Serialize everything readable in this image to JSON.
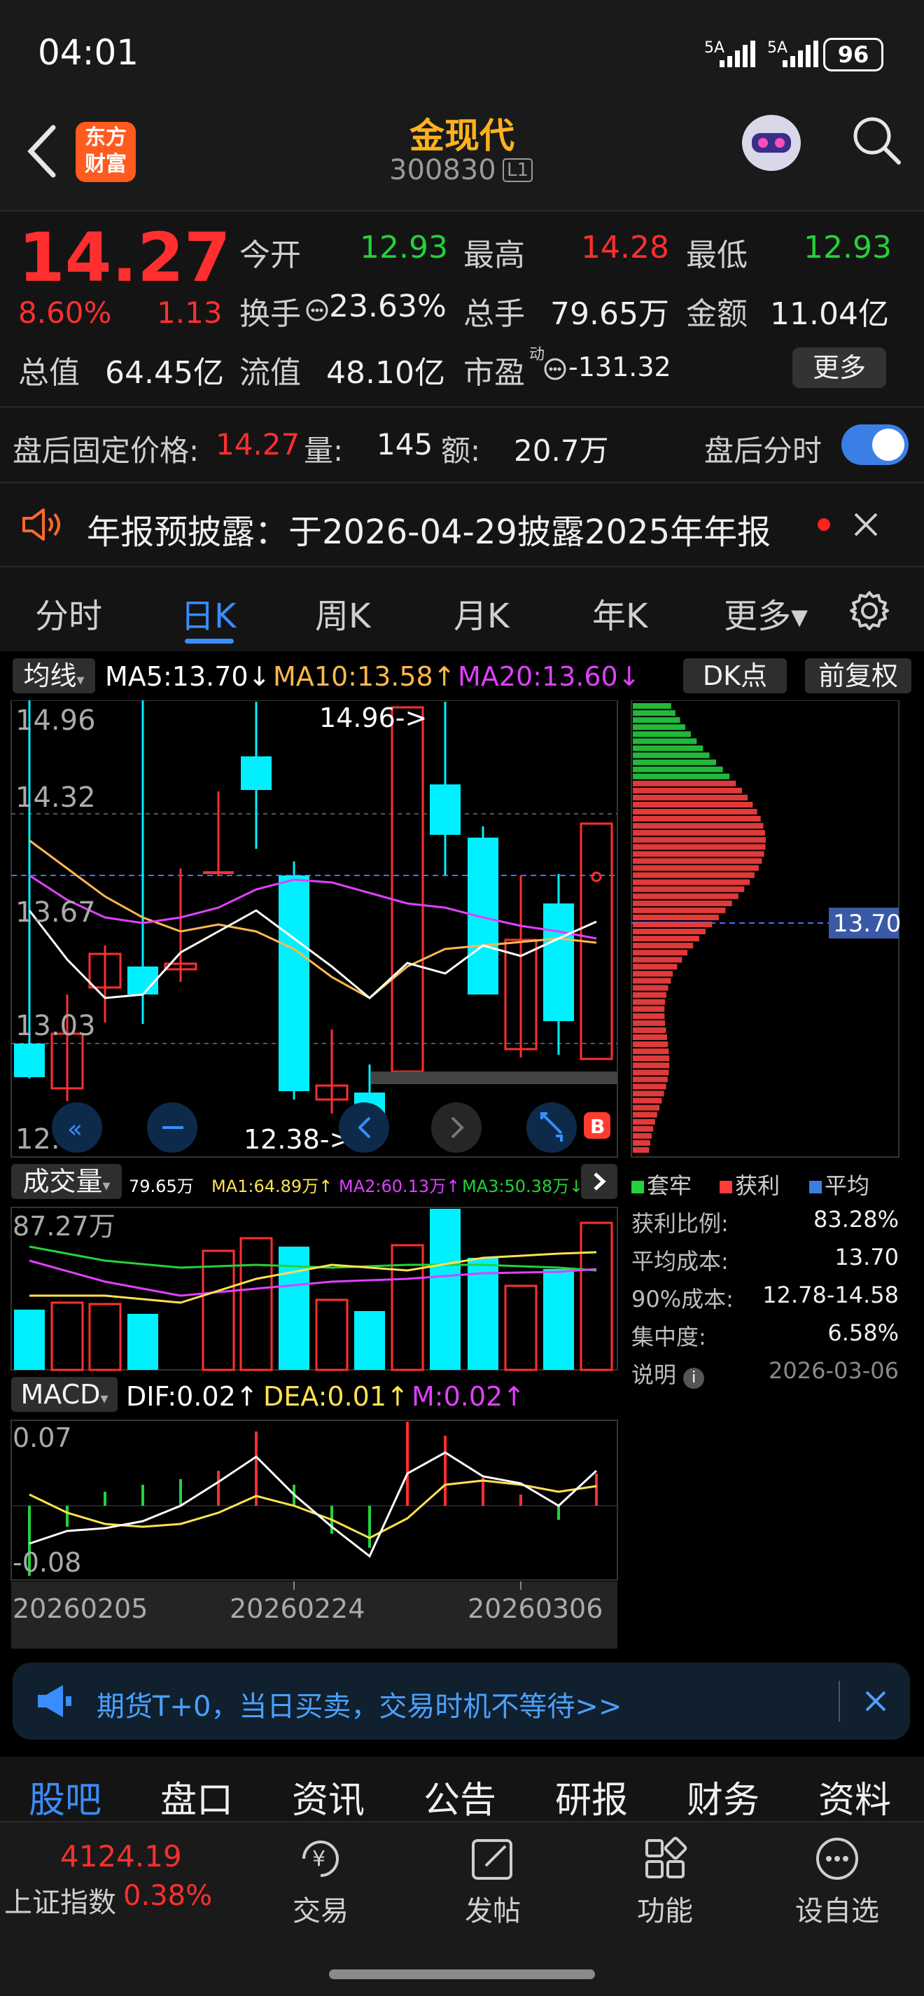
{
  "status_bar": {
    "time": "04:01",
    "signal1": "5A",
    "signal2": "5A",
    "battery": "96"
  },
  "header": {
    "name": "金现代",
    "code": "300830",
    "level": "L1",
    "logo_line1": "东方",
    "logo_line2": "财富"
  },
  "quote": {
    "price": "14.27",
    "change_pct": "8.60%",
    "change": "1.13",
    "open_label": "今开",
    "open": "12.93",
    "high_label": "最高",
    "high": "14.28",
    "low_label": "最低",
    "low": "12.93",
    "turnover_label": "换手",
    "turnover": "23.63%",
    "volume_label": "总手",
    "volume": "79.65万",
    "amount_label": "金额",
    "amount": "11.04亿",
    "mktcap_label": "总值",
    "mktcap": "64.45亿",
    "float_label": "流值",
    "float": "48.10亿",
    "pe_label": "市盈",
    "pe_sup": "动",
    "pe": "-131.32",
    "more_button": "更多"
  },
  "after_hours": {
    "label": "盘后固定价格:",
    "price": "14.27",
    "vol_label": "量:",
    "vol": "145",
    "amt_label": "额:",
    "amt": "20.7万",
    "toggle_label": "盘后分时"
  },
  "notice": {
    "text": "年报预披露：于2026-04-29披露2025年年报"
  },
  "tabs": [
    "分时",
    "日K",
    "周K",
    "月K",
    "年K",
    "更多▾"
  ],
  "ma_legend": {
    "selector": "均线",
    "ma5": "MA5:13.70↓",
    "ma10": "MA10:13.58↑",
    "ma20": "MA20:13.60↓",
    "dk_button": "DK点",
    "adjust_button": "前复权"
  },
  "kline": {
    "y_labels": [
      "14.96",
      "14.32",
      "13.67",
      "13.03",
      "12.38"
    ],
    "max_marker": "14.96->",
    "min_marker": "12.38->",
    "chip_price": "13.70"
  },
  "volume_panel": {
    "selector": "成交量",
    "total": "79.65万",
    "ma1": "MA1:64.89万↑",
    "ma2": "MA2:60.13万↑",
    "ma3": "MA3:50.38万↓",
    "ymax": "87.27万"
  },
  "macd_panel": {
    "selector": "MACD",
    "dif": "DIF:0.02↑",
    "dea": "DEA:0.01↑",
    "m": "M:0.02↑",
    "ymax": "0.07",
    "ymin": "-0.08"
  },
  "x_labels": [
    "20260205",
    "20260224",
    "20260306"
  ],
  "chip_dist": {
    "legend": [
      "套牢",
      "获利",
      "平均"
    ],
    "rows": [
      {
        "label": "获利比例:",
        "value": "83.28%"
      },
      {
        "label": "平均成本:",
        "value": "13.70"
      },
      {
        "label": "90%成本:",
        "value": "12.78-14.58"
      },
      {
        "label": "集中度:",
        "value": "6.58%"
      }
    ],
    "note_label": "说明",
    "date": "2026-03-06"
  },
  "ad_banner": {
    "text": "期货T+0，当日买卖，交易时机不等待>>"
  },
  "bottom_nav": [
    "股吧",
    "盘口",
    "资讯",
    "公告",
    "研报",
    "财务",
    "资料"
  ],
  "dock": {
    "index_value": "4124.19",
    "index_name": "上证指数",
    "index_change": "0.38%",
    "items": [
      "交易",
      "发帖",
      "功能",
      "设自选"
    ]
  },
  "colors": {
    "up": "#ff2f2f",
    "down": "#00f0ff",
    "accent": "#3a8dff",
    "ma5": "#ffffff",
    "ma10": "#ffb84d",
    "ma20": "#e040ff"
  }
}
